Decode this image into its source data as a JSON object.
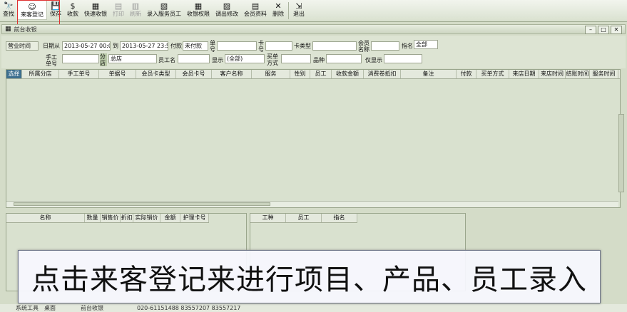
{
  "toolbar": [
    {
      "key": "query",
      "label": "查找",
      "icon": "🔭",
      "state": "normal"
    },
    {
      "key": "register",
      "label": "来客登记",
      "icon": "☺",
      "state": "active"
    },
    {
      "key": "save",
      "label": "保存",
      "icon": "💾",
      "state": "normal"
    },
    {
      "key": "checkout",
      "label": "收款",
      "icon": "$",
      "state": "normal"
    },
    {
      "key": "quick",
      "label": "快速收银",
      "icon": "▦",
      "state": "normal"
    },
    {
      "key": "print",
      "label": "打印",
      "icon": "▤",
      "state": "disabled"
    },
    {
      "key": "refresh",
      "label": "刷新",
      "icon": "▥",
      "state": "disabled"
    },
    {
      "key": "enter_staff",
      "label": "录入服务员工",
      "icon": "▧",
      "state": "normal"
    },
    {
      "key": "perm",
      "label": "收银权限",
      "icon": "▦",
      "state": "normal"
    },
    {
      "key": "adjust",
      "label": "调出修改",
      "icon": "▨",
      "state": "normal"
    },
    {
      "key": "member",
      "label": "会员资料",
      "icon": "▤",
      "state": "normal"
    },
    {
      "key": "delete",
      "label": "删除",
      "icon": "✕",
      "state": "normal"
    },
    {
      "key": "exit",
      "label": "退出",
      "icon": "⇲",
      "state": "normal"
    }
  ],
  "window": {
    "title": "前台收银"
  },
  "filters": {
    "business_time": "营业时间",
    "date_from_label": "日期从",
    "date_from": "2013-05-27 00:00",
    "date_to_label": "到",
    "date_to": "2013-05-27 23:59",
    "pay_label": "付款",
    "pay_value": "未付款",
    "order_no_label": "单号",
    "card_no_label": "卡号",
    "card_type_label": "卡类型",
    "member_name_label": "会员名称",
    "designate_label": "指名",
    "designate_value": "全部",
    "manual_no_label": "手工单号",
    "branch_label": "分店",
    "branch_value": "总店",
    "staff_name_label": "员工名",
    "display_label": "显示",
    "display_value": "(全部)",
    "buy_method_label": "买单方式",
    "product_label": "品种",
    "only_show_label": "仅显示"
  },
  "main_columns": [
    "选择",
    "所属分店",
    "手工单号",
    "单据号",
    "会员卡类型",
    "会员卡号",
    "客户名称",
    "服务",
    "性别",
    "员工",
    "收款金额",
    "消费卷抵扣",
    "备注",
    "付款",
    "买单方式",
    "来店日期",
    "来店时间",
    "结账时间",
    "服务时间"
  ],
  "product_columns": [
    "名称",
    "数量",
    "销售价",
    "折扣",
    "实际销价",
    "金额",
    "护理卡号"
  ],
  "staff_columns": [
    "工种",
    "员工",
    "指名"
  ],
  "statusbar": {
    "left": "系统工具",
    "mid": "桌面",
    "tab": "前台收银",
    "phone": "020-61151488 83557207 83557217"
  },
  "caption": "点击来客登记来进行项目、产品、员工录入"
}
